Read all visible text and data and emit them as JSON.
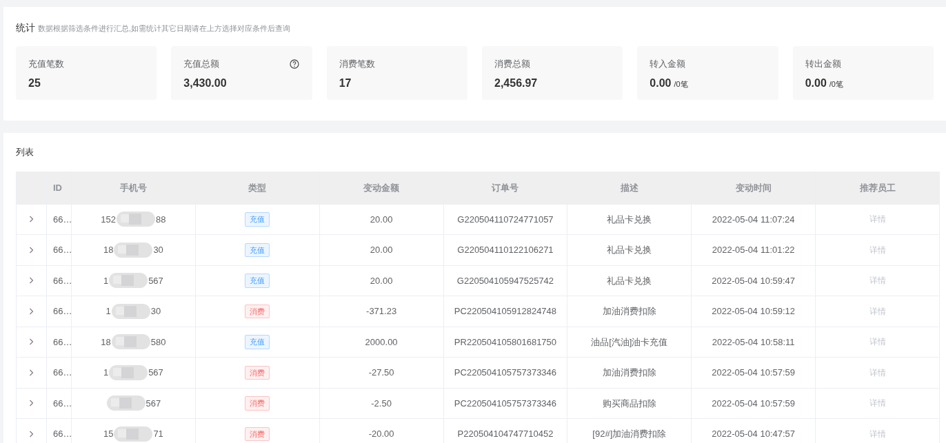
{
  "stats": {
    "title": "统计",
    "hint": "数据根据筛选条件进行汇总,如需统计其它日期请在上方选择对应条件后查询",
    "cards": [
      {
        "label": "充值笔数",
        "value": "25"
      },
      {
        "label": "充值总额",
        "value": "3,430.00",
        "help": true
      },
      {
        "label": "消费笔数",
        "value": "17"
      },
      {
        "label": "消费总额",
        "value": "2,456.97"
      },
      {
        "label": "转入金额",
        "value": "0.00",
        "unit": "/0笔"
      },
      {
        "label": "转出金额",
        "value": "0.00",
        "unit": "/0笔"
      }
    ]
  },
  "list": {
    "title": "列表",
    "columns": [
      "ID",
      "手机号",
      "类型",
      "变动金额",
      "订单号",
      "描述",
      "变动时间",
      "推荐员工"
    ],
    "rows": [
      {
        "id": "66…",
        "phone_start": "152",
        "phone_end": "88",
        "type": {
          "label": "充值",
          "kind": "recharge"
        },
        "amount": "20.00",
        "order": "G220504110724771057",
        "desc": "礼品卡兑换",
        "time": "2022-05-04 11:07:24",
        "action": "详情"
      },
      {
        "id": "66…",
        "phone_start": "18",
        "phone_end": "30",
        "type": {
          "label": "充值",
          "kind": "recharge"
        },
        "amount": "20.00",
        "order": "G220504110122106271",
        "desc": "礼品卡兑换",
        "time": "2022-05-04 11:01:22",
        "action": "详情"
      },
      {
        "id": "66…",
        "phone_start": "1",
        "phone_end": "567",
        "type": {
          "label": "充值",
          "kind": "recharge"
        },
        "amount": "20.00",
        "order": "G220504105947525742",
        "desc": "礼品卡兑换",
        "time": "2022-05-04 10:59:47",
        "action": "详情"
      },
      {
        "id": "66…",
        "phone_start": "1",
        "phone_end": "30",
        "type": {
          "label": "消费",
          "kind": "consume"
        },
        "amount": "-371.23",
        "order": "PC220504105912824748",
        "desc": "加油消费扣除",
        "time": "2022-05-04 10:59:12",
        "action": "详情"
      },
      {
        "id": "66…",
        "phone_start": "18",
        "phone_end": "580",
        "type": {
          "label": "充值",
          "kind": "recharge"
        },
        "amount": "2000.00",
        "order": "PR220504105801681750",
        "desc": "油品[汽油]油卡充值",
        "time": "2022-05-04 10:58:11",
        "action": "详情"
      },
      {
        "id": "66…",
        "phone_start": "1",
        "phone_end": "567",
        "type": {
          "label": "消费",
          "kind": "consume"
        },
        "amount": "-27.50",
        "order": "PC220504105757373346",
        "desc": "加油消费扣除",
        "time": "2022-05-04 10:57:59",
        "action": "详情"
      },
      {
        "id": "66…",
        "phone_end": "567",
        "type": {
          "label": "消费",
          "kind": "consume"
        },
        "amount": "-2.50",
        "order": "PC220504105757373346",
        "desc": "购买商品扣除",
        "time": "2022-05-04 10:57:59",
        "action": "详情"
      },
      {
        "id": "66…",
        "phone_start": "15",
        "phone_end": "71",
        "type": {
          "label": "消费",
          "kind": "consume"
        },
        "amount": "-20.00",
        "order": "P220504104747710452",
        "desc": "[92#]加油消费扣除",
        "time": "2022-05-04 10:47:57",
        "action": "详情"
      }
    ]
  }
}
